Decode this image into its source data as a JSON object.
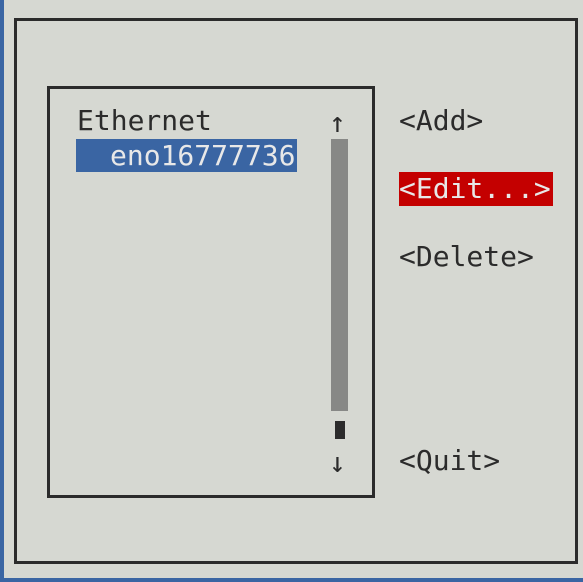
{
  "connections": {
    "group_label": "Ethernet",
    "items": [
      {
        "label": "eno16777736",
        "selected": true
      }
    ]
  },
  "scrollbar": {
    "up_arrow": "↑",
    "down_arrow": "↓"
  },
  "buttons": {
    "add": "<Add>",
    "edit": "<Edit...>",
    "delete": "<Delete>",
    "quit": "<Quit>"
  },
  "colors": {
    "background": "#d6d8d2",
    "selection": "#3a65a3",
    "focus_button": "#c40000",
    "scroll_track": "#878886",
    "border": "#2b2b2b"
  }
}
